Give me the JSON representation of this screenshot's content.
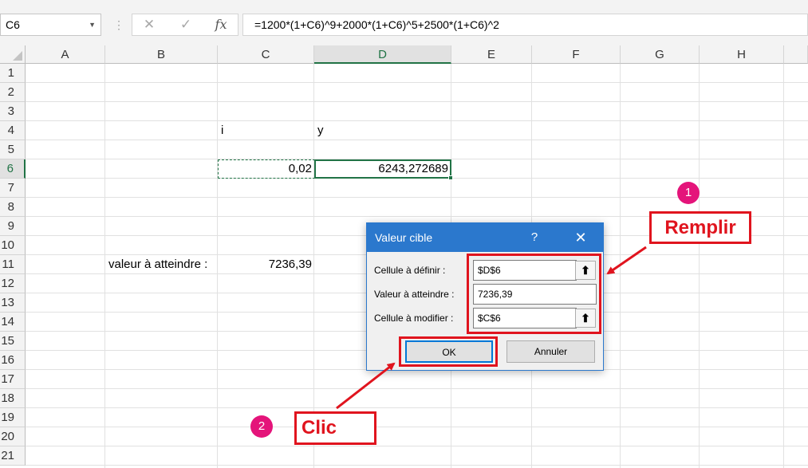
{
  "formula_bar": {
    "name_box": "C6",
    "separator": "⋮",
    "cancel_glyph": "✕",
    "enter_glyph": "✓",
    "fx_glyph": "fx",
    "formula": "=1200*(1+C6)^9+2000*(1+C6)^5+2500*(1+C6)^2"
  },
  "sheet": {
    "columns": [
      "A",
      "B",
      "C",
      "D",
      "E",
      "F",
      "G",
      "H"
    ],
    "rows": [
      "1",
      "2",
      "3",
      "4",
      "5",
      "6",
      "7",
      "8",
      "9",
      "10",
      "11",
      "12",
      "13",
      "14",
      "15",
      "16",
      "17",
      "18",
      "19",
      "20",
      "21"
    ],
    "selected_column": "D",
    "selected_row": "6",
    "cells": {
      "C4": "i",
      "D4": "y",
      "C6": "0,02",
      "D6": "6243,272689",
      "B11": "valeur à atteindre :",
      "C11": "7236,39"
    }
  },
  "dialog": {
    "title": "Valeur cible",
    "help": "?",
    "close": "✕",
    "set_cell_label": "Cellule à définir :",
    "set_cell_value": "$D$6",
    "to_value_label": "Valeur à atteindre :",
    "to_value_value": "7236,39",
    "changing_cell_label": "Cellule à modifier :",
    "changing_cell_value": "$C$6",
    "ref_glyph": "⬆",
    "ok_label": "OK",
    "cancel_label": "Annuler"
  },
  "annotations": {
    "step1_number": "1",
    "step1_text": "Remplir",
    "step2_number": "2",
    "step2_text": "Clic",
    "color": "#e0141e",
    "badge_color": "#e4147a"
  },
  "colors": {
    "excel_green": "#217346",
    "dialog_blue": "#2b78cd"
  }
}
